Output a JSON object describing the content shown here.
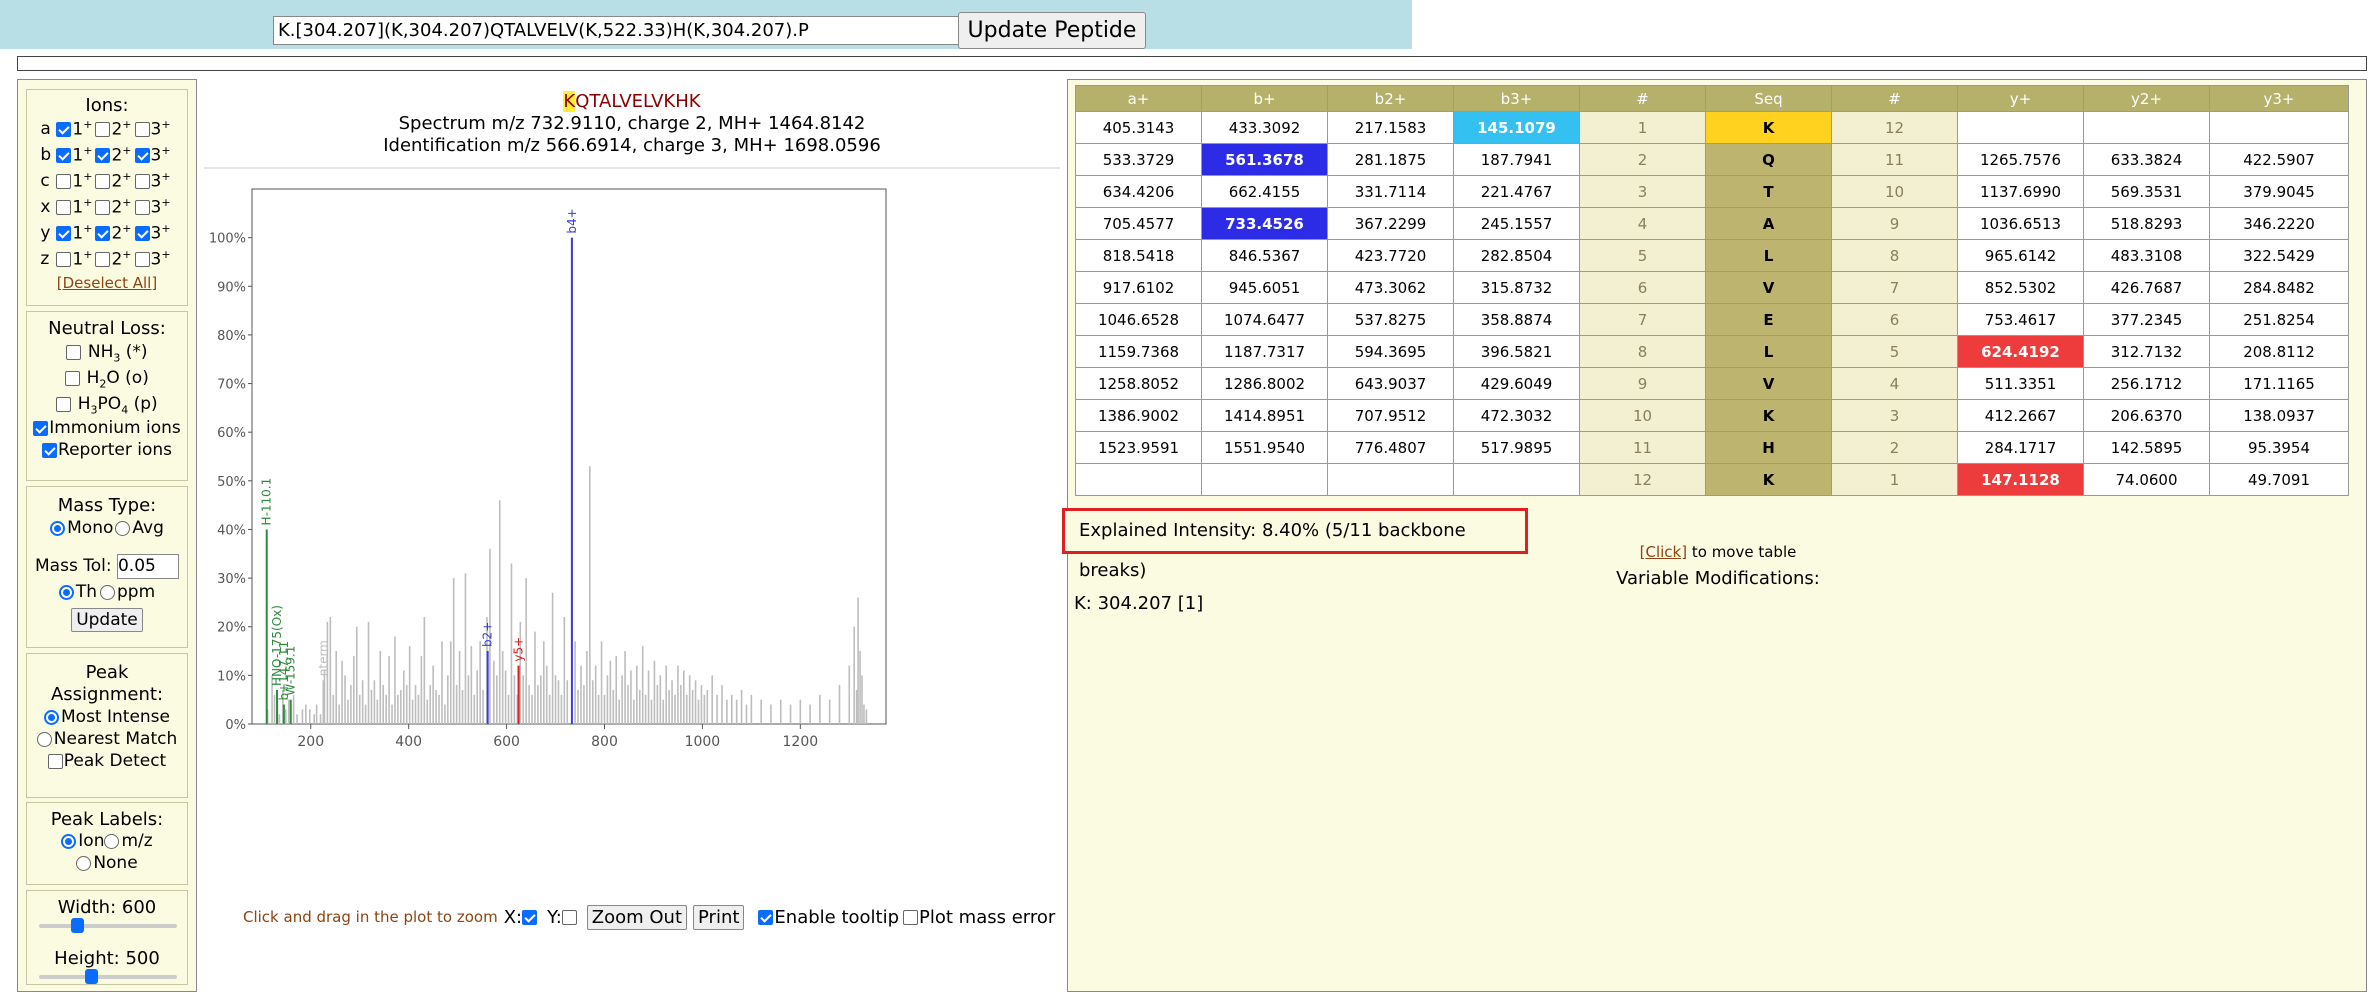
{
  "header": {
    "peptide_input": "K.[304.207](K,304.207)QTALVELV(K,522.33)H(K,304.207).P",
    "update_button": "Update Peptide"
  },
  "left": {
    "ions_title": "Ions:",
    "ion_rows": [
      {
        "label": "a",
        "c1": true,
        "c2": false,
        "c3": false
      },
      {
        "label": "b",
        "c1": true,
        "c2": true,
        "c3": true
      },
      {
        "label": "c",
        "c1": false,
        "c2": false,
        "c3": false
      },
      {
        "label": "x",
        "c1": false,
        "c2": false,
        "c3": false
      },
      {
        "label": "y",
        "c1": true,
        "c2": true,
        "c3": true
      },
      {
        "label": "z",
        "c1": false,
        "c2": false,
        "c3": false
      }
    ],
    "deselect_all": "[Deselect All]",
    "neutral_loss_title": "Neutral Loss:",
    "nl_nh3": "NH3 (*)",
    "nl_h2o": "H2O (o)",
    "nl_h3po4": "H3PO4 (p)",
    "immonium": "Immonium ions",
    "reporter": "Reporter ions",
    "mass_type_title": "Mass Type:",
    "mono": "Mono",
    "avg": "Avg",
    "mass_tol_label": "Mass Tol:",
    "mass_tol_value": "0.05",
    "th": "Th",
    "ppm": "ppm",
    "update_button": "Update",
    "peak_assign_title": "Peak Assignment:",
    "most_intense": "Most Intense",
    "nearest_match": "Nearest Match",
    "peak_detect": "Peak Detect",
    "peak_labels_title": "Peak Labels:",
    "ion": "Ion",
    "mz": "m/z",
    "none": "None",
    "width_label": "Width: 600",
    "height_label": "Height: 500"
  },
  "plot": {
    "seq_highlight": "K",
    "seq_rest": "QTALVELVKHK",
    "spectrum_line": "Spectrum m/z 732.9110, charge 2, MH+ 1464.8142",
    "ident_line": "Identification m/z 566.6914, charge 3, MH+ 1698.0596",
    "zoom_hint": "Click and drag in the plot to zoom",
    "x_label": "X:",
    "y_label": "Y:",
    "zoom_out": "Zoom Out",
    "print": "Print",
    "tooltip": "Enable tooltip",
    "mass_error": "Plot mass error"
  },
  "chart_data": {
    "type": "bar",
    "xlim": [
      80,
      1375
    ],
    "ylim": [
      0,
      110
    ],
    "xticks": [
      200,
      400,
      600,
      800,
      1000,
      1200
    ],
    "yticks": [
      0,
      10,
      20,
      30,
      40,
      50,
      60,
      70,
      80,
      90,
      100
    ],
    "ytick_suffix": "%",
    "colors": {
      "grey": "#bdbdbd",
      "b": "#3a3ad8",
      "y": "#e02020",
      "imm": "#2e8b3e"
    },
    "unlabeled_peaks": [
      [
        112,
        3
      ],
      [
        121,
        10
      ],
      [
        126,
        6
      ],
      [
        132,
        5
      ],
      [
        136,
        2
      ],
      [
        143,
        7
      ],
      [
        149,
        3
      ],
      [
        155,
        5
      ],
      [
        165,
        6
      ],
      [
        172,
        2
      ],
      [
        183,
        3
      ],
      [
        190,
        4
      ],
      [
        198,
        3
      ],
      [
        207,
        2
      ],
      [
        212,
        4
      ],
      [
        220,
        2
      ],
      [
        228,
        11
      ],
      [
        234,
        21
      ],
      [
        240,
        22
      ],
      [
        246,
        6
      ],
      [
        252,
        15
      ],
      [
        258,
        4
      ],
      [
        264,
        13
      ],
      [
        270,
        10
      ],
      [
        276,
        5
      ],
      [
        282,
        8
      ],
      [
        288,
        14
      ],
      [
        294,
        20
      ],
      [
        300,
        6
      ],
      [
        306,
        9
      ],
      [
        312,
        4
      ],
      [
        318,
        21
      ],
      [
        324,
        7
      ],
      [
        330,
        9
      ],
      [
        336,
        5
      ],
      [
        342,
        15
      ],
      [
        348,
        8
      ],
      [
        354,
        6
      ],
      [
        360,
        14
      ],
      [
        366,
        4
      ],
      [
        372,
        18
      ],
      [
        378,
        6
      ],
      [
        384,
        7
      ],
      [
        390,
        11
      ],
      [
        396,
        8
      ],
      [
        402,
        16
      ],
      [
        408,
        5
      ],
      [
        414,
        8
      ],
      [
        420,
        6
      ],
      [
        426,
        14
      ],
      [
        432,
        22
      ],
      [
        438,
        5
      ],
      [
        444,
        8
      ],
      [
        450,
        12
      ],
      [
        456,
        7
      ],
      [
        462,
        6
      ],
      [
        468,
        17
      ],
      [
        474,
        4
      ],
      [
        480,
        10
      ],
      [
        486,
        17
      ],
      [
        492,
        30
      ],
      [
        498,
        8
      ],
      [
        504,
        15
      ],
      [
        510,
        7
      ],
      [
        516,
        31
      ],
      [
        522,
        10
      ],
      [
        528,
        16
      ],
      [
        534,
        6
      ],
      [
        540,
        11
      ],
      [
        546,
        17
      ],
      [
        552,
        7
      ],
      [
        560,
        22
      ],
      [
        566,
        36
      ],
      [
        574,
        13
      ],
      [
        580,
        10
      ],
      [
        586,
        46
      ],
      [
        592,
        15
      ],
      [
        598,
        11
      ],
      [
        604,
        6
      ],
      [
        610,
        33
      ],
      [
        616,
        10
      ],
      [
        622,
        6
      ],
      [
        628,
        21
      ],
      [
        634,
        10
      ],
      [
        640,
        30
      ],
      [
        646,
        8
      ],
      [
        652,
        6
      ],
      [
        658,
        19
      ],
      [
        664,
        8
      ],
      [
        670,
        10
      ],
      [
        676,
        17
      ],
      [
        682,
        12
      ],
      [
        688,
        6
      ],
      [
        694,
        27
      ],
      [
        700,
        10
      ],
      [
        706,
        9
      ],
      [
        712,
        6
      ],
      [
        718,
        22
      ],
      [
        724,
        9
      ],
      [
        740,
        17
      ],
      [
        746,
        7
      ],
      [
        752,
        12
      ],
      [
        758,
        8
      ],
      [
        764,
        15
      ],
      [
        770,
        53
      ],
      [
        776,
        9
      ],
      [
        782,
        12
      ],
      [
        788,
        6
      ],
      [
        794,
        17
      ],
      [
        800,
        6
      ],
      [
        806,
        10
      ],
      [
        812,
        13
      ],
      [
        818,
        7
      ],
      [
        824,
        14
      ],
      [
        830,
        5
      ],
      [
        836,
        10
      ],
      [
        842,
        15
      ],
      [
        848,
        8
      ],
      [
        854,
        11
      ],
      [
        860,
        5
      ],
      [
        866,
        12
      ],
      [
        872,
        7
      ],
      [
        878,
        16
      ],
      [
        884,
        6
      ],
      [
        890,
        11
      ],
      [
        896,
        5
      ],
      [
        902,
        13
      ],
      [
        908,
        8
      ],
      [
        914,
        10
      ],
      [
        920,
        5
      ],
      [
        926,
        12
      ],
      [
        932,
        7
      ],
      [
        938,
        9
      ],
      [
        944,
        6
      ],
      [
        950,
        12
      ],
      [
        956,
        8
      ],
      [
        962,
        11
      ],
      [
        968,
        6
      ],
      [
        974,
        10
      ],
      [
        980,
        7
      ],
      [
        986,
        9
      ],
      [
        992,
        5
      ],
      [
        998,
        8
      ],
      [
        1004,
        6
      ],
      [
        1010,
        7
      ],
      [
        1020,
        10
      ],
      [
        1030,
        6
      ],
      [
        1040,
        8
      ],
      [
        1050,
        5
      ],
      [
        1060,
        6
      ],
      [
        1070,
        5
      ],
      [
        1080,
        7
      ],
      [
        1090,
        4
      ],
      [
        1100,
        6
      ],
      [
        1120,
        5
      ],
      [
        1140,
        4
      ],
      [
        1160,
        5
      ],
      [
        1180,
        4
      ],
      [
        1200,
        5
      ],
      [
        1220,
        4
      ],
      [
        1240,
        6
      ],
      [
        1260,
        5
      ],
      [
        1280,
        8
      ],
      [
        1300,
        12
      ],
      [
        1310,
        20
      ],
      [
        1315,
        7
      ],
      [
        1318,
        26
      ],
      [
        1322,
        15
      ],
      [
        1326,
        10
      ],
      [
        1330,
        4
      ],
      [
        1335,
        3
      ]
    ],
    "labeled_peaks": [
      {
        "x": 733.45,
        "y": 100,
        "label": "b4+",
        "kind": "b"
      },
      {
        "x": 561.37,
        "y": 15,
        "label": "b2+",
        "kind": "b"
      },
      {
        "x": 624.42,
        "y": 12,
        "label": "y5+",
        "kind": "y"
      },
      {
        "x": 110.07,
        "y": 40,
        "label": "H-110.1",
        "kind": "imm"
      },
      {
        "x": 131.1,
        "y": 7,
        "label": "HNO-175(Ox)",
        "kind": "imm"
      },
      {
        "x": 145.1,
        "y": 4,
        "label": "b+147.11",
        "kind": "imm"
      },
      {
        "x": 159.1,
        "y": 5,
        "label": "W-159.1",
        "kind": "imm"
      },
      {
        "x": 226.0,
        "y": 9,
        "label": "nterm",
        "kind": "grey"
      }
    ]
  },
  "table": {
    "headers": [
      "a+",
      "b+",
      "b2+",
      "b3+",
      "#",
      "Seq",
      "#",
      "y+",
      "y2+",
      "y3+"
    ],
    "rows": [
      {
        "a": "405.3143",
        "b": "433.3092",
        "b2": "217.1583",
        "b3": "145.1079",
        "n1": "1",
        "seq": "K",
        "n2": "12",
        "y": "",
        "y2": "",
        "y3": ""
      },
      {
        "a": "533.3729",
        "b": "561.3678",
        "b2": "281.1875",
        "b3": "187.7941",
        "n1": "2",
        "seq": "Q",
        "n2": "11",
        "y": "1265.7576",
        "y2": "633.3824",
        "y3": "422.5907"
      },
      {
        "a": "634.4206",
        "b": "662.4155",
        "b2": "331.7114",
        "b3": "221.4767",
        "n1": "3",
        "seq": "T",
        "n2": "10",
        "y": "1137.6990",
        "y2": "569.3531",
        "y3": "379.9045"
      },
      {
        "a": "705.4577",
        "b": "733.4526",
        "b2": "367.2299",
        "b3": "245.1557",
        "n1": "4",
        "seq": "A",
        "n2": "9",
        "y": "1036.6513",
        "y2": "518.8293",
        "y3": "346.2220"
      },
      {
        "a": "818.5418",
        "b": "846.5367",
        "b2": "423.7720",
        "b3": "282.8504",
        "n1": "5",
        "seq": "L",
        "n2": "8",
        "y": "965.6142",
        "y2": "483.3108",
        "y3": "322.5429"
      },
      {
        "a": "917.6102",
        "b": "945.6051",
        "b2": "473.3062",
        "b3": "315.8732",
        "n1": "6",
        "seq": "V",
        "n2": "7",
        "y": "852.5302",
        "y2": "426.7687",
        "y3": "284.8482"
      },
      {
        "a": "1046.6528",
        "b": "1074.6477",
        "b2": "537.8275",
        "b3": "358.8874",
        "n1": "7",
        "seq": "E",
        "n2": "6",
        "y": "753.4617",
        "y2": "377.2345",
        "y3": "251.8254"
      },
      {
        "a": "1159.7368",
        "b": "1187.7317",
        "b2": "594.3695",
        "b3": "396.5821",
        "n1": "8",
        "seq": "L",
        "n2": "5",
        "y": "624.4192",
        "y2": "312.7132",
        "y3": "208.8112"
      },
      {
        "a": "1258.8052",
        "b": "1286.8002",
        "b2": "643.9037",
        "b3": "429.6049",
        "n1": "9",
        "seq": "V",
        "n2": "4",
        "y": "511.3351",
        "y2": "256.1712",
        "y3": "171.1165"
      },
      {
        "a": "1386.9002",
        "b": "1414.8951",
        "b2": "707.9512",
        "b3": "472.3032",
        "n1": "10",
        "seq": "K",
        "n2": "3",
        "y": "412.2667",
        "y2": "206.6370",
        "y3": "138.0937"
      },
      {
        "a": "1523.9591",
        "b": "1551.9540",
        "b2": "776.4807",
        "b3": "517.9895",
        "n1": "11",
        "seq": "H",
        "n2": "2",
        "y": "284.1717",
        "y2": "142.5895",
        "y3": "95.3954"
      },
      {
        "a": "",
        "b": "",
        "b2": "",
        "b3": "",
        "n1": "12",
        "seq": "K",
        "n2": "1",
        "y": "147.1128",
        "y2": "74.0600",
        "y3": "49.7091"
      }
    ],
    "matched": {
      "b": [
        1,
        3
      ],
      "b3": [
        0
      ],
      "y": [
        7,
        11
      ]
    },
    "highlight_seq": [
      0
    ],
    "explained_intensity_label": "Explained Intensity:",
    "explained_intensity_value": "8.40% (5/11 backbone breaks)",
    "move_link": "[Click]",
    "move_text": " to move table",
    "varmod_title": "Variable Modifications:",
    "varmod_text": "K: 304.207 [1]"
  }
}
